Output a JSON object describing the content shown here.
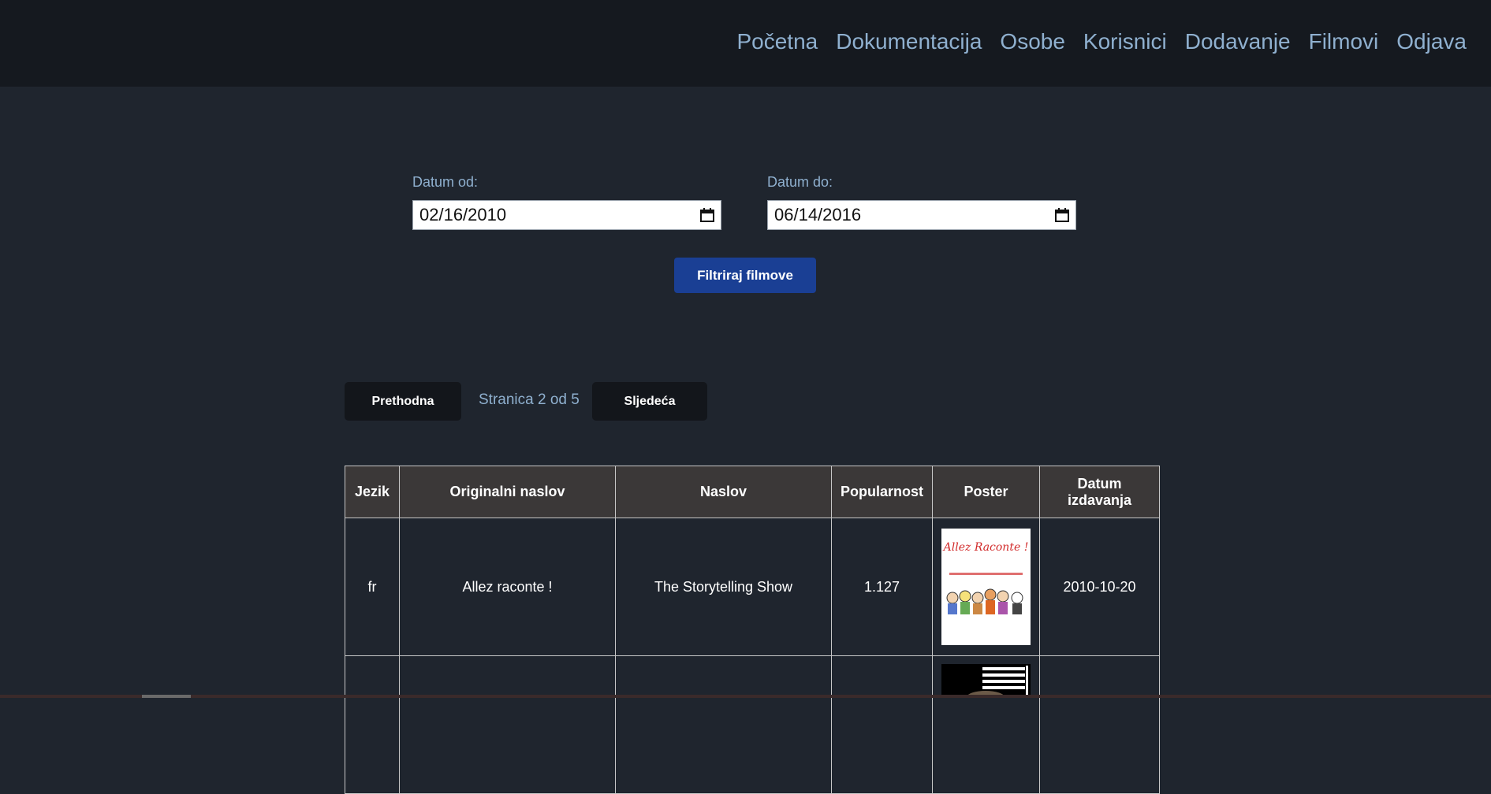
{
  "nav": {
    "items": [
      "Početna",
      "Dokumentacija",
      "Osobe",
      "Korisnici",
      "Dodavanje",
      "Filmovi",
      "Odjava"
    ]
  },
  "filter": {
    "from_label": "Datum od:",
    "from_value": "02/16/2010",
    "to_label": "Datum do:",
    "to_value": "06/14/2016",
    "button_label": "Filtriraj filmove"
  },
  "pager": {
    "prev_label": "Prethodna",
    "status": "Stranica 2 od 5",
    "next_label": "Sljedeća"
  },
  "table": {
    "headers": [
      "Jezik",
      "Originalni naslov",
      "Naslov",
      "Popularnost",
      "Poster",
      "Datum izdavanja"
    ],
    "rows": [
      {
        "language": "fr",
        "original_title": "Allez raconte !",
        "title": "The Storytelling Show",
        "popularity": "1.127",
        "poster_title": "Allez Raconte !",
        "release_date": "2010-10-20"
      },
      {
        "language": "",
        "original_title": "",
        "title": "",
        "popularity": "",
        "poster_title": "",
        "release_date": ""
      }
    ]
  },
  "colors": {
    "background": "#1f252e",
    "topbar": "#15191f",
    "nav_link": "#8fb0cf",
    "filter_button": "#1a3f94",
    "pager_button": "#13161b",
    "table_header": "#3b3838"
  }
}
